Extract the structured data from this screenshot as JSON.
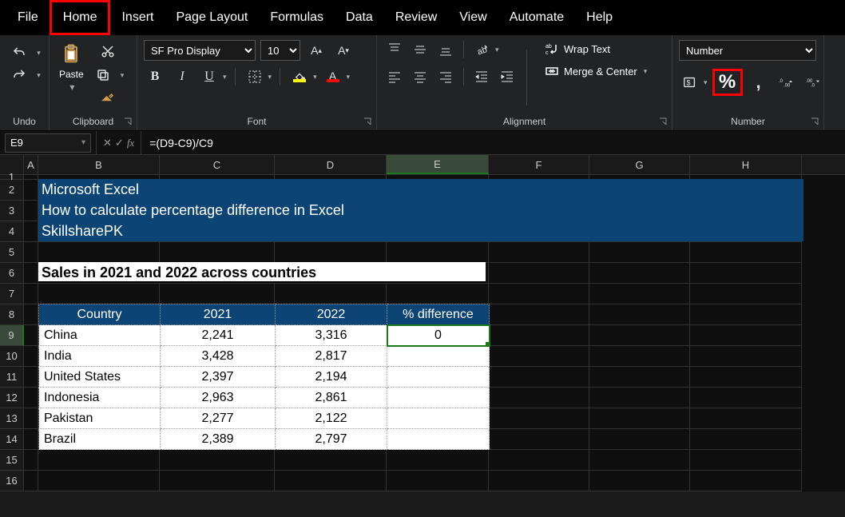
{
  "menu": {
    "items": [
      "File",
      "Home",
      "Insert",
      "Page Layout",
      "Formulas",
      "Data",
      "Review",
      "View",
      "Automate",
      "Help"
    ],
    "active": "Home"
  },
  "ribbon": {
    "undo_label": "Undo",
    "clipboard_label": "Clipboard",
    "paste_label": "Paste",
    "font_label": "Font",
    "font_name": "SF Pro Display",
    "font_size": "10",
    "bold": "B",
    "italic": "I",
    "underline": "U",
    "alignment_label": "Alignment",
    "wrap_text": "Wrap Text",
    "merge_center": "Merge & Center",
    "number_label": "Number",
    "number_format": "Number",
    "accounting_sym": "$",
    "percent_sym": "%",
    "comma_sym": ",",
    "inc_dec": ".00",
    "dec_dec": ".00"
  },
  "formula_bar": {
    "namebox": "E9",
    "cancel": "✕",
    "enter": "✓",
    "fx": "fx",
    "formula": "=(D9-C9)/C9"
  },
  "columns": [
    "A",
    "B",
    "C",
    "D",
    "E",
    "F",
    "G",
    "H"
  ],
  "selected_col": "E",
  "rows": [
    1,
    2,
    3,
    4,
    5,
    6,
    7,
    8,
    9,
    10,
    11,
    12,
    13,
    14,
    15,
    16
  ],
  "selected_row": 9,
  "banner": {
    "line1": "Microsoft Excel",
    "line2": "How to calculate percentage difference in Excel",
    "line3": "SkillsharePK"
  },
  "section_title": "Sales in 2021 and 2022 across countries",
  "table": {
    "headers": [
      "Country",
      "2021",
      "2022",
      "% difference"
    ],
    "rows": [
      {
        "country": "China",
        "y2021": "2,241",
        "y2022": "3,316",
        "diff": "0"
      },
      {
        "country": "India",
        "y2021": "3,428",
        "y2022": "2,817",
        "diff": ""
      },
      {
        "country": "United States",
        "y2021": "2,397",
        "y2022": "2,194",
        "diff": ""
      },
      {
        "country": "Indonesia",
        "y2021": "2,963",
        "y2022": "2,861",
        "diff": ""
      },
      {
        "country": "Pakistan",
        "y2021": "2,277",
        "y2022": "2,122",
        "diff": ""
      },
      {
        "country": "Brazil",
        "y2021": "2,389",
        "y2022": "2,797",
        "diff": ""
      }
    ]
  }
}
